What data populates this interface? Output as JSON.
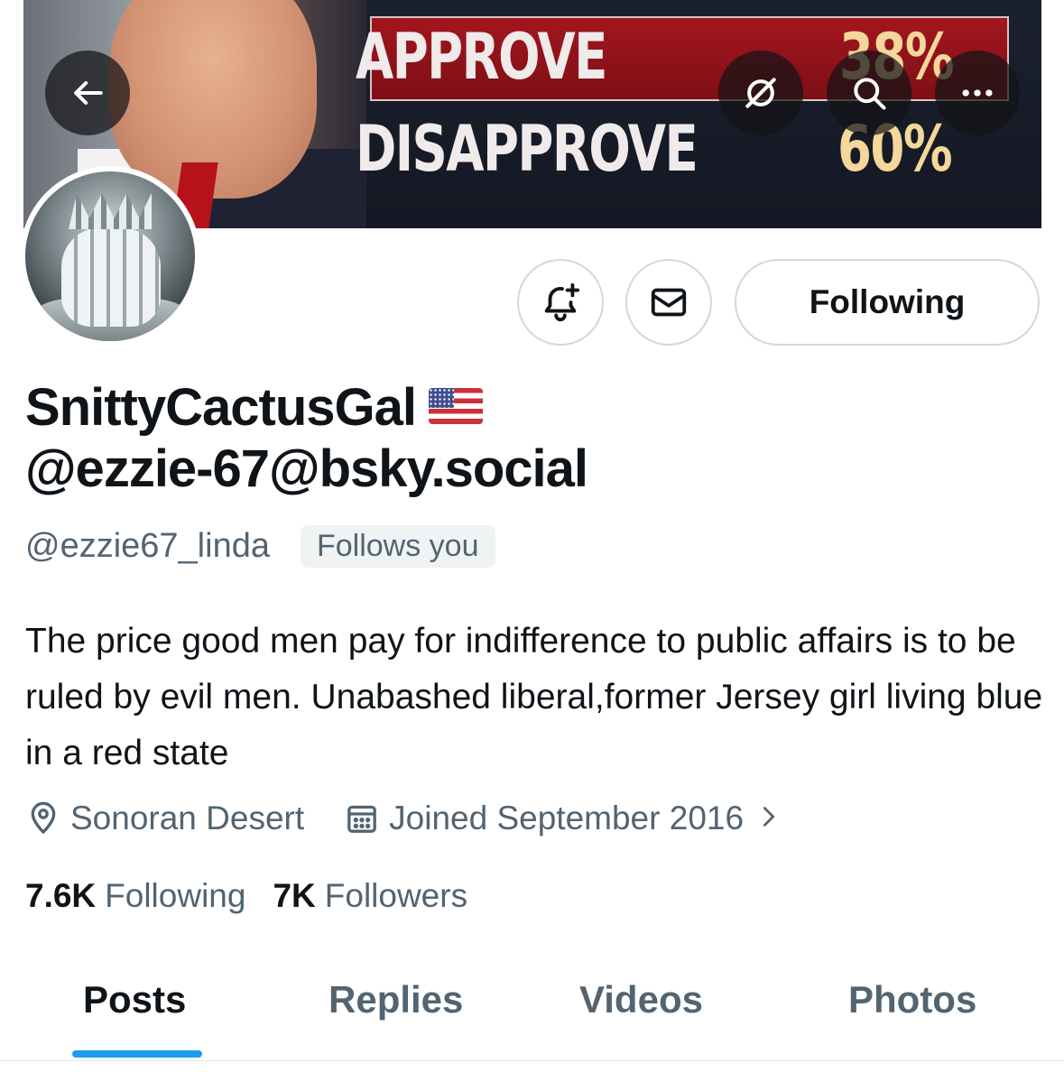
{
  "banner": {
    "poll_approve_label": "APPROVE",
    "poll_approve_value": "38%",
    "poll_disapprove_label": "DISAPPROVE",
    "poll_disapprove_value": "60%"
  },
  "header_icons": {
    "back": "arrow-left-icon",
    "grok": "grok-icon",
    "search": "search-icon",
    "more": "more-icon"
  },
  "actions": {
    "notify": "bell-plus-icon",
    "message": "envelope-icon",
    "following_label": "Following"
  },
  "profile": {
    "display_name_line1": "SnittyCactusGal",
    "display_name_line2": "@ezzie-67@bsky.social",
    "handle": "@ezzie67_linda",
    "follows_you": "Follows you",
    "bio": "The price good men pay for indifference to public affairs is to be ruled by evil men. Unabashed liberal,former Jersey girl living blue in a red state",
    "location": "Sonoran Desert",
    "joined": "Joined September 2016",
    "following_count": "7.6K",
    "following_label": "Following",
    "followers_count": "7K",
    "followers_label": "Followers"
  },
  "tabs": [
    {
      "label": "Posts",
      "active": true
    },
    {
      "label": "Replies",
      "active": false
    },
    {
      "label": "Videos",
      "active": false
    },
    {
      "label": "Photos",
      "active": false
    }
  ],
  "colors": {
    "accent": "#1d9bf0",
    "secondary_text": "#536471",
    "primary_text": "#0f1419",
    "border": "#cfd9de"
  }
}
